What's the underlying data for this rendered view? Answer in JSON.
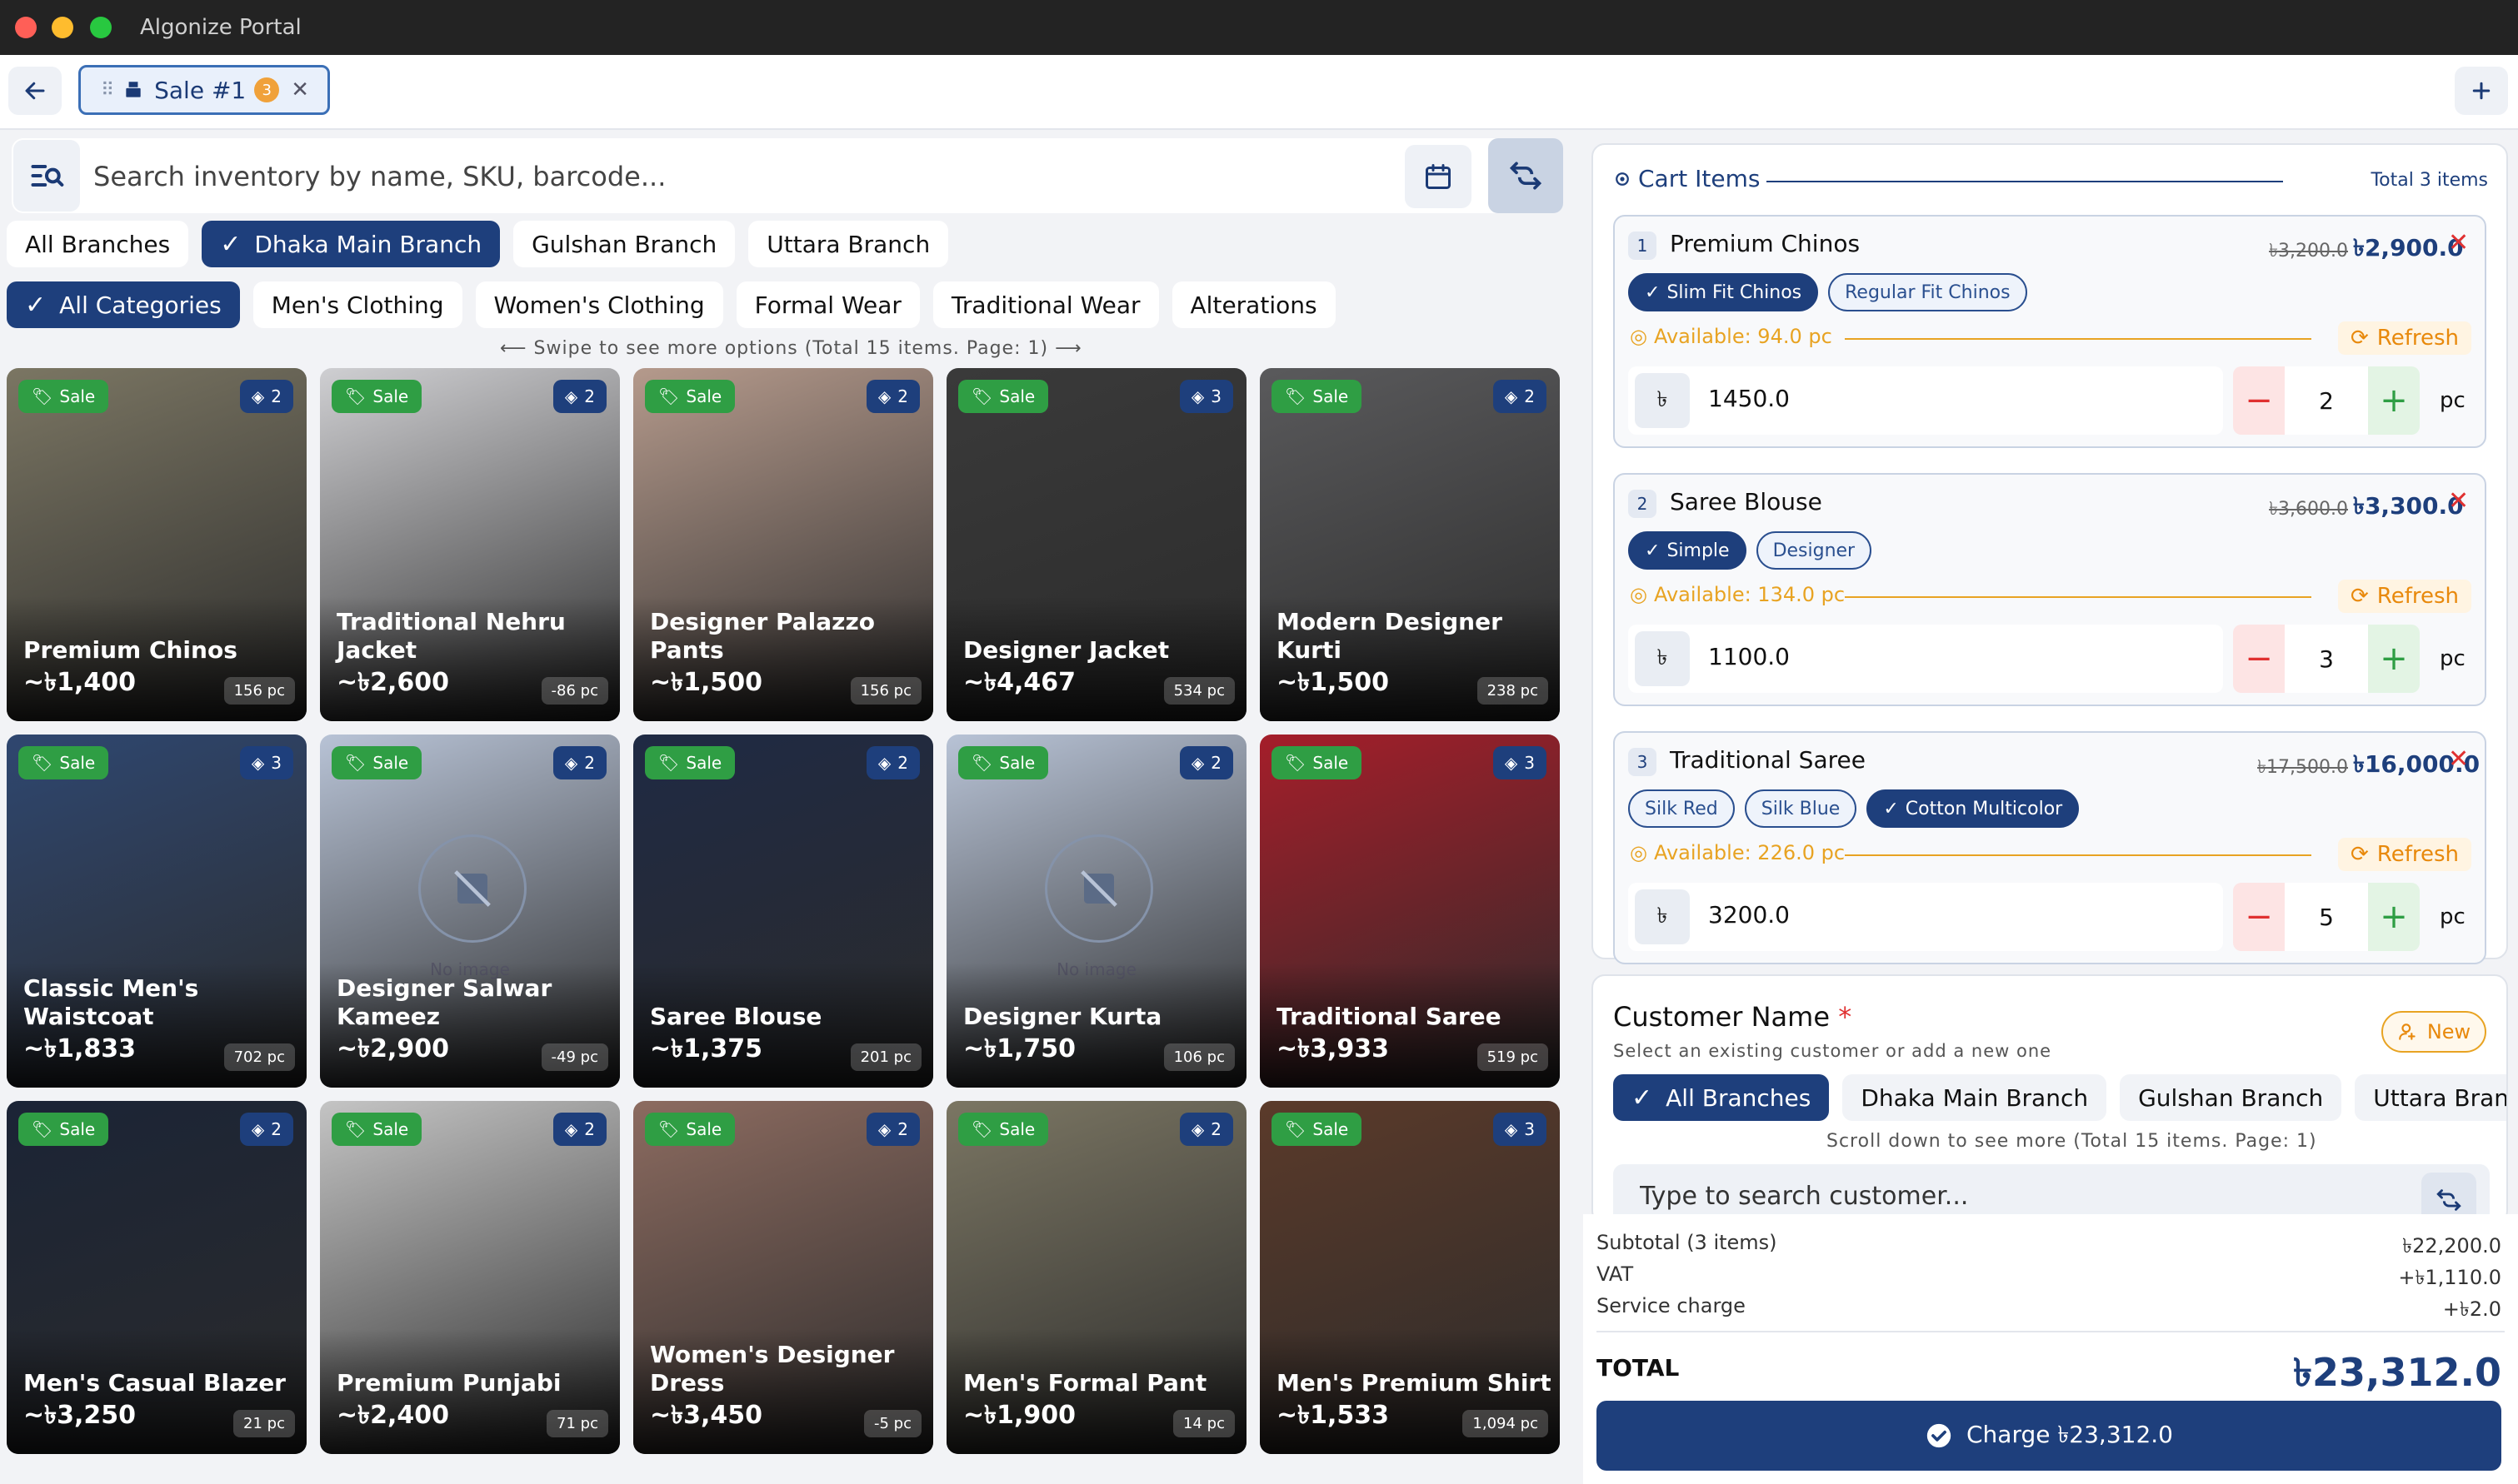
{
  "window": {
    "title": "Algonize Portal"
  },
  "tabs": [
    {
      "label": "Sale #1",
      "badge": "3"
    }
  ],
  "search": {
    "placeholder": "Search inventory by name, SKU, barcode..."
  },
  "branches": [
    "All Branches",
    "Dhaka Main Branch",
    "Gulshan Branch",
    "Uttara Branch"
  ],
  "categories": [
    "All Categories",
    "Men's Clothing",
    "Women's Clothing",
    "Formal Wear",
    "Traditional Wear",
    "Alterations"
  ],
  "swipe_hint": "Swipe to see more options (Total 15 items. Page: 1)",
  "sale_label": "Sale",
  "products": [
    {
      "name": "Premium Chinos",
      "price": "~৳1,400",
      "stock": "156 pc",
      "variants": "2",
      "color": "#7b7663"
    },
    {
      "name": "Traditional Nehru Jacket",
      "price": "~৳2,600",
      "stock": "-86 pc",
      "variants": "2",
      "color": "#cfcfd2"
    },
    {
      "name": "Designer Palazzo Pants",
      "price": "~৳1,500",
      "stock": "156 pc",
      "variants": "2",
      "color": "#b59a8c"
    },
    {
      "name": "Designer Jacket",
      "price": "~৳4,467",
      "stock": "534 pc",
      "variants": "3",
      "color": "#3a3a3a"
    },
    {
      "name": "Modern Designer Kurti",
      "price": "~৳1,500",
      "stock": "238 pc",
      "variants": "2",
      "color": "#5a5a5c"
    },
    {
      "name": "Classic Men's Waistcoat",
      "price": "~৳1,833",
      "stock": "702 pc",
      "variants": "3",
      "color": "#2f4770"
    },
    {
      "name": "Designer Salwar Kameez",
      "price": "~৳2,900",
      "stock": "-49 pc",
      "variants": "2",
      "color": "#b8c3d6"
    },
    {
      "name": "Saree Blouse",
      "price": "~৳1,375",
      "stock": "201 pc",
      "variants": "2",
      "color": "#1f2a44"
    },
    {
      "name": "Designer Kurta",
      "price": "~৳1,750",
      "stock": "106 pc",
      "variants": "2",
      "color": "#b8c3d6"
    },
    {
      "name": "Traditional Saree",
      "price": "~৳3,933",
      "stock": "519 pc",
      "variants": "3",
      "color": "#a51e2a"
    },
    {
      "name": "Men's Casual Blazer",
      "price": "~৳3,250",
      "stock": "21 pc",
      "variants": "2",
      "color": "#1b2436"
    },
    {
      "name": "Premium Punjabi",
      "price": "~৳2,400",
      "stock": "71 pc",
      "variants": "2",
      "color": "#c4c4c4"
    },
    {
      "name": "Women's Designer Dress",
      "price": "~৳3,450",
      "stock": "-5 pc",
      "variants": "2",
      "color": "#8c6b60"
    },
    {
      "name": "Men's Formal Pant",
      "price": "~৳1,900",
      "stock": "14 pc",
      "variants": "2",
      "color": "#7b7663"
    },
    {
      "name": "Men's Premium Shirt",
      "price": "~৳1,533",
      "stock": "1,094 pc",
      "variants": "3",
      "color": "#5b3a2a"
    }
  ],
  "no_image_label": "No image",
  "cart": {
    "title": "Cart Items",
    "total_items": "Total 3 items",
    "available_prefix": "Available:",
    "refresh_label": "Refresh",
    "currency_symbol": "৳",
    "unit": "pc",
    "items": [
      {
        "index": "1",
        "name": "Premium Chinos",
        "old_price": "৳3,200.0",
        "new_price": "৳2,900.0",
        "variants": [
          {
            "label": "Slim Fit Chinos",
            "selected": true
          },
          {
            "label": "Regular Fit Chinos",
            "selected": false
          }
        ],
        "available": "Available: 94.0 pc",
        "unit_price": "1450.0",
        "qty": "2"
      },
      {
        "index": "2",
        "name": "Saree Blouse",
        "old_price": "৳3,600.0",
        "new_price": "৳3,300.0",
        "variants": [
          {
            "label": "Simple",
            "selected": true
          },
          {
            "label": "Designer",
            "selected": false
          }
        ],
        "available": "Available: 134.0 pc",
        "unit_price": "1100.0",
        "qty": "3"
      },
      {
        "index": "3",
        "name": "Traditional Saree",
        "old_price": "৳17,500.0",
        "new_price": "৳16,000.0",
        "variants": [
          {
            "label": "Silk Red",
            "selected": false
          },
          {
            "label": "Silk Blue",
            "selected": false
          },
          {
            "label": "Cotton Multicolor",
            "selected": true
          }
        ],
        "available": "Available: 226.0 pc",
        "unit_price": "3200.0",
        "qty": "5"
      }
    ]
  },
  "customer": {
    "title": "Customer Name",
    "required_mark": "*",
    "subtitle": "Select an existing customer or add a new one",
    "new_label": "New",
    "branches": [
      "All Branches",
      "Dhaka Main Branch",
      "Gulshan Branch",
      "Uttara Branch"
    ],
    "scroll_hint": "Scroll down to see more (Total 15 items. Page: 1)",
    "search_placeholder": "Type to search customer..."
  },
  "summary": {
    "subtotal_label": "Subtotal (3 items)",
    "subtotal": "৳22,200.0",
    "vat_label": "VAT",
    "vat": "+৳1,110.0",
    "service_label": "Service charge",
    "service": "+৳2.0",
    "total_label": "TOTAL",
    "total": "৳23,312.0",
    "charge_label": "Charge ৳23,312.0"
  }
}
